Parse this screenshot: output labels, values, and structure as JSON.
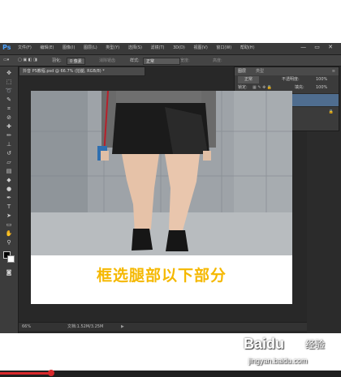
{
  "app": {
    "logo": "Ps",
    "menu": [
      "文件(F)",
      "编辑(E)",
      "图像(I)",
      "图层(L)",
      "类型(Y)",
      "选择(S)",
      "滤镜(T)",
      "3D(D)",
      "视图(V)",
      "窗口(W)",
      "帮助(H)"
    ],
    "window_controls": "— ▭ ✕"
  },
  "options_bar": {
    "feather_label": "羽化:",
    "feather_value": "0 像素",
    "antialias": "消除锯齿",
    "style_label": "样式:",
    "style_value": "正常",
    "width_label": "宽度:",
    "height_label": "高度:"
  },
  "document": {
    "tab_title": "抖音 PS教程.psd @ 66.7% (拍腿, RGB/8) *",
    "caption": "框选腿部以下部分"
  },
  "status": {
    "zoom": "66%",
    "doc_size": "文档:1.52M/3.25M"
  },
  "layers_panel": {
    "tabs": "图层",
    "kind": "类型",
    "blend_mode": "正常",
    "opacity_label": "不透明度:",
    "opacity_value": "100%",
    "lock_label": "锁定:",
    "fill_label": "填充:",
    "fill_value": "100%",
    "layers": [
      {
        "name": "拍腿",
        "selected": true
      },
      {
        "name": "背景",
        "selected": false
      }
    ]
  },
  "watermark": {
    "brand": "Baidu",
    "brand_cn": "经验",
    "url": "jingyan.baidu.com"
  },
  "colors": {
    "caption": "#f5b800",
    "selected_layer": "#4f6d8f",
    "progress": "#d8282b"
  },
  "video_progress": 0.15
}
